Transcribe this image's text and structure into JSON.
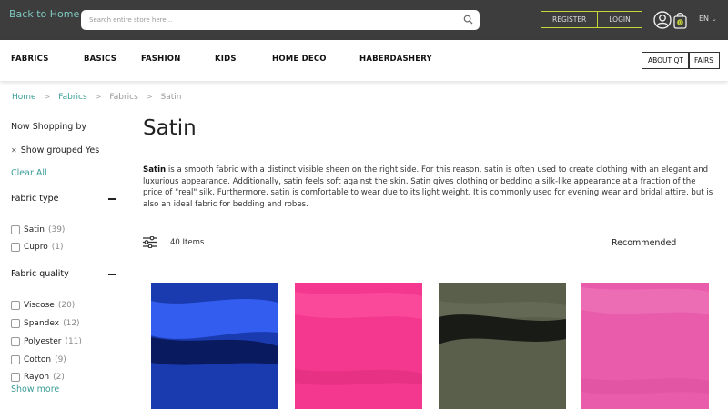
{
  "header": {
    "back_home": "Back to Home",
    "search_placeholder": "Search entire store here...",
    "register": "REGISTER",
    "login": "LOGIN",
    "language": "EN"
  },
  "nav": {
    "items": [
      "FABRICS",
      "BASICS",
      "FASHION",
      "KIDS",
      "HOME DECO",
      "HABERDASHERY"
    ],
    "about": "ABOUT QT",
    "fairs": "FAIRS"
  },
  "breadcrumb": [
    "Home",
    "Fabrics",
    "Fabrics",
    "Satin"
  ],
  "sidebar": {
    "now_shopping": "Now Shopping by",
    "active_filter": "Show grouped Yes",
    "clear_all": "Clear All",
    "fabric_type": {
      "title": "Fabric type",
      "options": [
        {
          "label": "Satin",
          "count": "(39)"
        },
        {
          "label": "Cupro",
          "count": "(1)"
        }
      ]
    },
    "fabric_quality": {
      "title": "Fabric quality",
      "options": [
        {
          "label": "Viscose",
          "count": "(20)"
        },
        {
          "label": "Spandex",
          "count": "(12)"
        },
        {
          "label": "Polyester",
          "count": "(11)"
        },
        {
          "label": "Cotton",
          "count": "(9)"
        },
        {
          "label": "Rayon",
          "count": "(2)"
        }
      ]
    },
    "show_more": "Show more"
  },
  "main": {
    "title": "Satin",
    "description_bold": "Satin",
    "description_rest": " is a smooth fabric with a distinct visible sheen on the right side. For this reason, satin is often used to create clothing with an elegant and luxurious appearance. Additionally, satin feels soft against the skin. Satin gives clothing or bedding a silk-like appearance at a fraction of the price of \"real\" silk. Furthermore, satin is comfortable to wear due to its light weight. It is commonly used for evening wear and bridal attire, but is also an ideal fabric for bedding and robes.",
    "items_count": "40 Items",
    "sort_label": "Recommended"
  },
  "products": [
    {
      "color": "#1a3bb0",
      "sheen": "#3a66ff",
      "dark": "#071550"
    },
    {
      "color": "#f4388f",
      "sheen": "#ff5aa8",
      "dark": "#d82a7c"
    },
    {
      "color": "#5a5f4c",
      "sheen": "#6b705c",
      "dark": "#151713"
    },
    {
      "color": "#e95bab",
      "sheen": "#f27fc0",
      "dark": "#d84e9c"
    }
  ],
  "colors": {
    "topbar": "#3d3d3d",
    "accent_teal": "#3a9c95",
    "auth_border": "#c9d638"
  }
}
